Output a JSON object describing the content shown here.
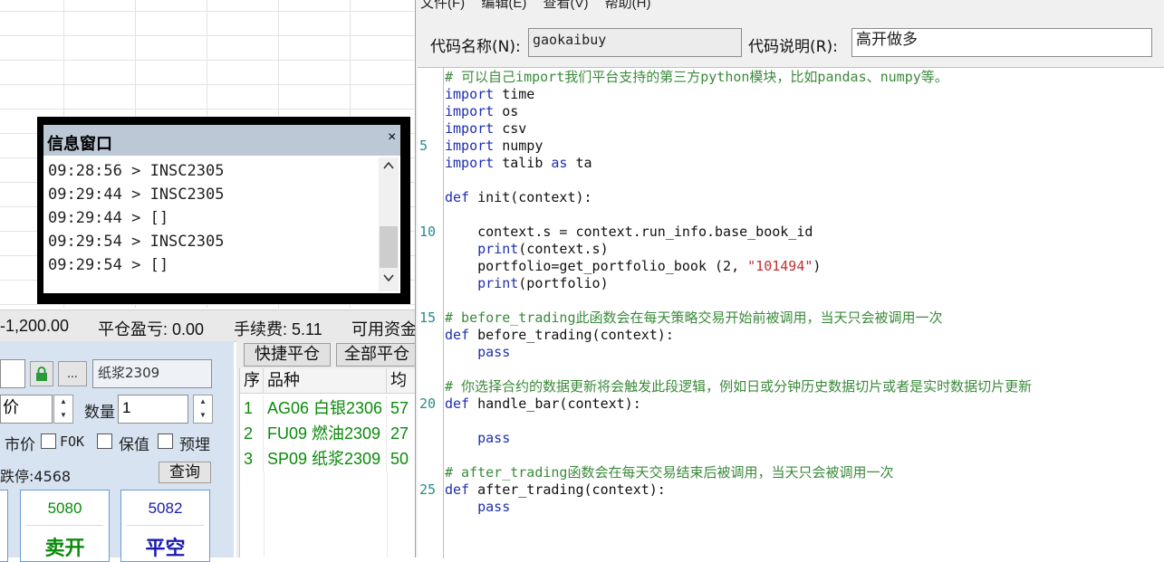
{
  "menu": {
    "items": [
      "文件(F)",
      "编辑(E)",
      "查看(V)",
      "帮助(H)"
    ]
  },
  "form": {
    "code_name_label": "代码名称(N):",
    "code_name_value": "gaokaibuy",
    "code_desc_label": "代码说明(R):",
    "code_desc_value": "高开做多"
  },
  "info_window": {
    "title": "信息窗口",
    "close": "×",
    "lines": [
      "09:28:56 > INSC2305",
      "09:29:44 > INSC2305",
      "09:29:44 > []",
      "09:29:54 > INSC2305",
      "09:29:54 > []"
    ]
  },
  "status_bar": {
    "item1": "-1,200.00",
    "item2": "平仓盈亏: 0.00",
    "item3": "手续费: 5.11",
    "item4": "可用资金"
  },
  "trade_panel": {
    "contract": "纸浆2309",
    "more_btn": "...",
    "price_label": "价",
    "qty_label": "数量",
    "qty_value": "1",
    "opt_market": "市价",
    "opt_fok": "FOK",
    "opt_hedge": "保值",
    "opt_preorder": "预埋",
    "limit_down": "跌停:4568",
    "query_btn": "查询",
    "sell_open": {
      "price": "5080",
      "label": "卖开"
    },
    "close_short": {
      "price": "5082",
      "label": "平空"
    }
  },
  "positions": {
    "tab_quick_close": "快捷平仓",
    "tab_close_all": "全部平仓",
    "headers": [
      "序",
      "品种",
      "均"
    ],
    "rows": [
      [
        "1",
        "AG06 白银2306",
        "57"
      ],
      [
        "2",
        "FU09 燃油2309",
        "27"
      ],
      [
        "3",
        "SP09 纸浆2309",
        "50"
      ]
    ]
  },
  "editor": {
    "line_numbers": [
      "5",
      "10",
      "15",
      "20",
      "25"
    ],
    "code": {
      "l1": "# 可以自己import我们平台支持的第三方python模块，比如pandas、numpy等。",
      "import": "import",
      "as": "as",
      "m_time": " time",
      "m_os": " os",
      "m_csv": " csv",
      "m_numpy": " numpy",
      "m_talib": " talib ",
      "m_ta": " ta",
      "def": "def",
      "init_sig": " init(context):",
      "l10a": "    context.s = context.run_info.base_book_id",
      "print": "print",
      "l11b": "(context.s)",
      "l12a": "    portfolio=get_portfolio_book (2, ",
      "l12s": "\"101494\"",
      "l12c": ")",
      "l13b": "(portfolio)",
      "c15": "# before_trading此函数会在每天策略交易开始前被调用，当天只会被调用一次",
      "before_sig": " before_trading(context):",
      "pass": "pass",
      "c19": "# 你选择合约的数据更新将会触发此段逻辑，例如日或分钟历史数据切片或者是实时数据切片更新",
      "handle_sig": " handle_bar(context):",
      "c24": "# after_trading函数会在每天交易结束后被调用，当天只会被调用一次",
      "after_sig": " after_trading(context):"
    }
  }
}
